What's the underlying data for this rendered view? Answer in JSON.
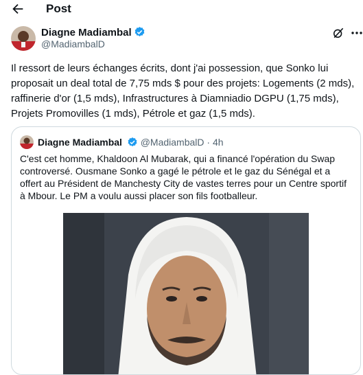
{
  "header": {
    "title": "Post"
  },
  "post": {
    "author_name": "Diagne Madiambal",
    "author_handle": "@MadiambalD",
    "text": "Il ressort de leurs échanges écrits, dont j'ai possession, que Sonko lui proposait un deal total de 7,75 mds $ pour des projets: Logements (2 mds), raffinerie d'or (1,5 mds), Infrastructures à Diamniadio DGPU (1,75 mds), Projets Promovilles (1 mds), Pétrole et gaz (1,5 mds)."
  },
  "quote": {
    "author_name": "Diagne Madiambal",
    "author_handle": "@MadiambalD",
    "separator": "·",
    "time": "4h",
    "text": "C'est cet homme, Khaldoon Al Mubarak, qui a financé l'opération du Swap controversé. Ousmane Sonko a gagé le pétrole et le gaz du Sénégal et a offert au Président de Manchesty City de vastes terres pour un Centre sportif à Mbour. Le PM a voulu aussi placer son fils footballeur."
  },
  "colors": {
    "verified": "#1d9bf0",
    "secondary_text": "#536471",
    "border": "#cfd9de"
  }
}
